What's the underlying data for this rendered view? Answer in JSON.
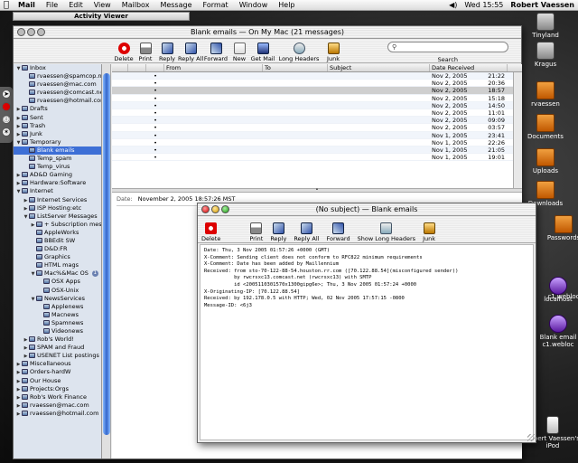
{
  "menubar": {
    "app": "Mail",
    "items": [
      "File",
      "Edit",
      "View",
      "Mailbox",
      "Message",
      "Format",
      "Window",
      "Help"
    ],
    "clock": "Wed 15:55",
    "user": "Robert Vaessen"
  },
  "activity_viewer": {
    "title": "Activity Viewer"
  },
  "main_window": {
    "title": "Blank emails — On My Mac (21 messages)",
    "toolbar": {
      "delete": "Delete",
      "print": "Print",
      "reply": "Reply",
      "reply_all": "Reply All",
      "forward": "Forward",
      "new": "New",
      "get_mail": "Get Mail",
      "long_headers": "Long Headers",
      "junk": "Junk"
    },
    "search": {
      "placeholder": "",
      "label": "Search"
    },
    "columns": {
      "from": "From",
      "to": "To",
      "subject": "Subject",
      "date": "Date Received"
    },
    "messages": [
      {
        "date": "Nov 2, 2005",
        "time": "21:22"
      },
      {
        "date": "Nov 2, 2005",
        "time": "20:36"
      },
      {
        "date": "Nov 2, 2005",
        "time": "18:57"
      },
      {
        "date": "Nov 2, 2005",
        "time": "15:18"
      },
      {
        "date": "Nov 2, 2005",
        "time": "14:50"
      },
      {
        "date": "Nov 2, 2005",
        "time": "11:01"
      },
      {
        "date": "Nov 2, 2005",
        "time": "09:09"
      },
      {
        "date": "Nov 2, 2005",
        "time": "03:57"
      },
      {
        "date": "Nov 1, 2005",
        "time": "23:41"
      },
      {
        "date": "Nov 1, 2005",
        "time": "22:26"
      },
      {
        "date": "Nov 1, 2005",
        "time": "21:05"
      },
      {
        "date": "Nov 1, 2005",
        "time": "19:01"
      }
    ],
    "preview": {
      "date_label": "Date:",
      "date_value": "November 2, 2005 18:57:26 MST"
    }
  },
  "sidebar": [
    {
      "label": "Inbox",
      "indent": 0,
      "tri": "▼"
    },
    {
      "label": "rvaessen@spamcop.net",
      "indent": 1,
      "tri": ""
    },
    {
      "label": "rvaessen@mac.com",
      "indent": 1,
      "tri": ""
    },
    {
      "label": "rvaessen@comcast.net",
      "indent": 1,
      "tri": ""
    },
    {
      "label": "rvaessen@hotmail.com",
      "indent": 1,
      "tri": ""
    },
    {
      "label": "Drafts",
      "indent": 0,
      "tri": "▶"
    },
    {
      "label": "Sent",
      "indent": 0,
      "tri": "▶"
    },
    {
      "label": "Trash",
      "indent": 0,
      "tri": "▶"
    },
    {
      "label": "Junk",
      "indent": 0,
      "tri": "▶"
    },
    {
      "label": "Temporary",
      "indent": 0,
      "tri": "▼"
    },
    {
      "label": "Blank emails",
      "indent": 1,
      "tri": "",
      "selected": true
    },
    {
      "label": "Temp_spam",
      "indent": 1,
      "tri": ""
    },
    {
      "label": "Temp_virus",
      "indent": 1,
      "tri": ""
    },
    {
      "label": "AD&D Gaming",
      "indent": 0,
      "tri": "▶"
    },
    {
      "label": "Hardware:Software",
      "indent": 0,
      "tri": "▶"
    },
    {
      "label": "Internet",
      "indent": 0,
      "tri": "▼"
    },
    {
      "label": "Internet Services",
      "indent": 1,
      "tri": "▶"
    },
    {
      "label": "ISP Hosting:etc",
      "indent": 1,
      "tri": "▶"
    },
    {
      "label": "ListServer Messages",
      "indent": 1,
      "tri": "▼"
    },
    {
      "label": "+ Subscription messages",
      "indent": 2,
      "tri": "▶"
    },
    {
      "label": "AppleWorks",
      "indent": 2,
      "tri": ""
    },
    {
      "label": "BBEdit SW",
      "indent": 2,
      "tri": ""
    },
    {
      "label": "D&D:FR",
      "indent": 2,
      "tri": ""
    },
    {
      "label": "Graphics",
      "indent": 2,
      "tri": ""
    },
    {
      "label": "HTML mags",
      "indent": 2,
      "tri": ""
    },
    {
      "label": "Mac%&Mac OS",
      "indent": 2,
      "tri": "▼",
      "badge": "1"
    },
    {
      "label": "OSX Apps",
      "indent": 3,
      "tri": ""
    },
    {
      "label": "OSX-Unix",
      "indent": 3,
      "tri": ""
    },
    {
      "label": "NewsServices",
      "indent": 2,
      "tri": "▼"
    },
    {
      "label": "Applenews",
      "indent": 3,
      "tri": ""
    },
    {
      "label": "Macnews",
      "indent": 3,
      "tri": ""
    },
    {
      "label": "Spamnews",
      "indent": 3,
      "tri": ""
    },
    {
      "label": "Videonews",
      "indent": 3,
      "tri": ""
    },
    {
      "label": "Rob's World!",
      "indent": 1,
      "tri": "▶"
    },
    {
      "label": "SPAM and Fraud",
      "indent": 1,
      "tri": "▶"
    },
    {
      "label": "USENET List postings",
      "indent": 1,
      "tri": "▶"
    },
    {
      "label": "Miscellaneous",
      "indent": 0,
      "tri": "▶"
    },
    {
      "label": "Orders-hardW",
      "indent": 0,
      "tri": "▶"
    },
    {
      "label": "Our House",
      "indent": 0,
      "tri": "▶"
    },
    {
      "label": "Projects:Orgs",
      "indent": 0,
      "tri": "▶"
    },
    {
      "label": "Rob's Work Finance",
      "indent": 0,
      "tri": "▶"
    },
    {
      "label": "rvaessen@mac.com",
      "indent": 0,
      "tri": "▶"
    },
    {
      "label": "rvaessen@hotmail.com",
      "indent": 0,
      "tri": "▶"
    }
  ],
  "message_window": {
    "title": "(No subject) — Blank emails",
    "toolbar": {
      "delete": "Delete",
      "print": "Print",
      "reply": "Reply",
      "reply_all": "Reply All",
      "forward": "Forward",
      "show_long_headers": "Show Long Headers",
      "junk": "Junk"
    },
    "raw_headers": [
      "Date: Thu, 3 Nov 2005 01:57:26 +0000 (GMT)",
      "X-Comment: Sending client does not conform to RFC822 minimum requirements",
      "X-Comment: Date has been added by Maillennium",
      "Received: from sto-70-122-88-54.houston.rr.com ([70.122.88.54](misconfigured sender))",
      "          by rwcrsxc13.comcast.net (rwcrsxc13) with SMTP",
      "          id <2005110301570x1300gipg6e>; Thu, 3 Nov 2005 01:57:24 +0000",
      "X-Originating-IP: [70.122.88.54]",
      "Received: by 192.178.0.5 with HTTP; Wed, 02 Nov 2005 17:57:15 -0800",
      "Message-ID: <6j3"
    ]
  },
  "desktop_icons": [
    {
      "label": "Tinyland",
      "kind": "drive"
    },
    {
      "label": "Kragus",
      "kind": "drive"
    },
    {
      "label": "rvaessen",
      "kind": "folder"
    },
    {
      "label": "Documents",
      "kind": "folder"
    },
    {
      "label": "Uploads",
      "kind": "folder"
    },
    {
      "label": "Downloads",
      "kind": "folder"
    },
    {
      "label": "Passwords",
      "kind": "folder"
    },
    {
      "label": "localhost",
      "kind": "webloc"
    },
    {
      "label": "c1.webloc",
      "kind": "webloc"
    },
    {
      "label": "Blank email c1.webloc",
      "kind": "webloc"
    },
    {
      "label": "Robert Vaessen's iPod",
      "kind": "ipod"
    }
  ]
}
